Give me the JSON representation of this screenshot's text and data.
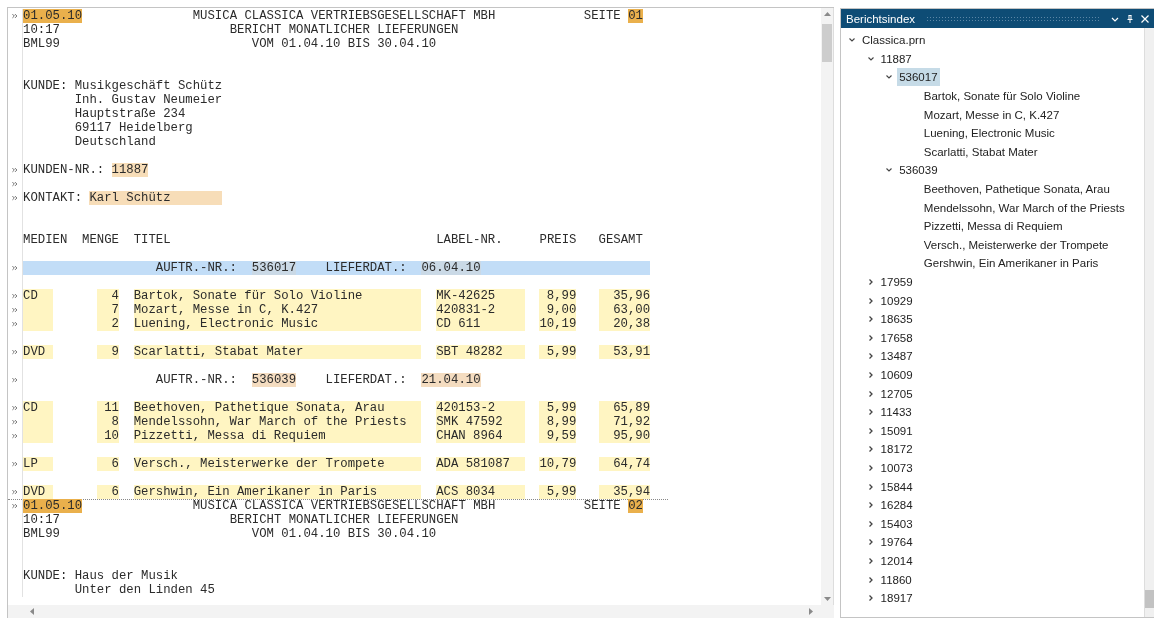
{
  "report": {
    "pages": [
      {
        "date": "01.05.10",
        "company": "MUSICA CLASSICA VERTRIEBSGESELLSCHAFT MBH",
        "page_label": "SEITE",
        "page_no": "01",
        "time": "10:17",
        "title": "BERICHT MONATLICHER LIEFERUNGEN",
        "program": "BML99",
        "period": "VOM 01.04.10 BIS 30.04.10",
        "customer": {
          "label": "KUNDE:",
          "lines": [
            "Musikgeschäft Schütz",
            "Inh. Gustav Neumeier",
            "Hauptstraße 234",
            "69117 Heidelberg",
            "Deutschland"
          ]
        },
        "customer_no": {
          "label": "KUNDEN-NR.:",
          "value": "11887"
        },
        "contact": {
          "label": "KONTAKT:",
          "value": "Karl Schütz"
        },
        "columns": [
          "MEDIEN",
          "MENGE",
          "TITEL",
          "LABEL-NR.",
          "PREIS",
          "GESAMT"
        ],
        "orders": [
          {
            "label": "AUFTR.-NR.:",
            "number": "536017",
            "date_label": "LIEFERDAT.:",
            "date": "06.04.10",
            "selected": true,
            "groups": [
              {
                "media": "CD",
                "items": [
                  {
                    "qty": "4",
                    "title": "Bartok, Sonate für Solo Violine",
                    "label_no": "MK-42625",
                    "price": "8,99",
                    "total": "35,96"
                  },
                  {
                    "qty": "7",
                    "title": "Mozart, Messe in C, K.427",
                    "label_no": "420831-2",
                    "price": "9,00",
                    "total": "63,00"
                  },
                  {
                    "qty": "2",
                    "title": "Luening, Electronic Music",
                    "label_no": "CD 611",
                    "price": "10,19",
                    "total": "20,38"
                  }
                ]
              },
              {
                "media": "DVD",
                "items": [
                  {
                    "qty": "9",
                    "title": "Scarlatti, Stabat Mater",
                    "label_no": "SBT 48282",
                    "price": "5,99",
                    "total": "53,91"
                  }
                ]
              }
            ]
          },
          {
            "label": "AUFTR.-NR.:",
            "number": "536039",
            "date_label": "LIEFERDAT.:",
            "date": "21.04.10",
            "selected": false,
            "groups": [
              {
                "media": "CD",
                "items": [
                  {
                    "qty": "11",
                    "title": "Beethoven, Pathetique Sonata, Arau",
                    "label_no": "420153-2",
                    "price": "5,99",
                    "total": "65,89"
                  },
                  {
                    "qty": "8",
                    "title": "Mendelssohn, War March of the Priests",
                    "label_no": "SMK 47592",
                    "price": "8,99",
                    "total": "71,92"
                  },
                  {
                    "qty": "10",
                    "title": "Pizzetti, Messa di Requiem",
                    "label_no": "CHAN 8964",
                    "price": "9,59",
                    "total": "95,90"
                  }
                ]
              },
              {
                "media": "LP",
                "items": [
                  {
                    "qty": "6",
                    "title": "Versch., Meisterwerke der Trompete",
                    "label_no": "ADA 581087",
                    "price": "10,79",
                    "total": "64,74"
                  }
                ]
              },
              {
                "media": "DVD",
                "items": [
                  {
                    "qty": "6",
                    "title": "Gershwin, Ein Amerikaner in Paris",
                    "label_no": "ACS 8034",
                    "price": "5,99",
                    "total": "35,94"
                  }
                ]
              }
            ]
          }
        ]
      },
      {
        "date": "01.05.10",
        "company": "MUSICA CLASSICA VERTRIEBSGESELLSCHAFT MBH",
        "page_label": "SEITE",
        "page_no": "02",
        "time": "10:17",
        "title": "BERICHT MONATLICHER LIEFERUNGEN",
        "program": "BML99",
        "period": "VOM 01.04.10 BIS 30.04.10",
        "customer": {
          "label": "KUNDE:",
          "lines": [
            "Haus der Musik",
            "Unter den Linden 45"
          ]
        }
      }
    ]
  },
  "index": {
    "title": "Berichtsindex",
    "nodes": [
      {
        "label": "Classica.prn",
        "expanded": true,
        "selected": false,
        "children": [
          {
            "label": "11887",
            "expanded": true,
            "selected": false,
            "children": [
              {
                "label": "536017",
                "expanded": true,
                "selected": true,
                "children": [
                  {
                    "label": "Bartok, Sonate für Solo Violine",
                    "selected": false
                  },
                  {
                    "label": "Mozart, Messe in C, K.427",
                    "selected": false
                  },
                  {
                    "label": "Luening, Electronic Music",
                    "selected": false
                  },
                  {
                    "label": "Scarlatti, Stabat Mater",
                    "selected": false
                  }
                ]
              },
              {
                "label": "536039",
                "expanded": true,
                "selected": false,
                "children": [
                  {
                    "label": "Beethoven, Pathetique Sonata, Arau",
                    "selected": false
                  },
                  {
                    "label": "Mendelssohn, War March of the Priests",
                    "selected": false
                  },
                  {
                    "label": "Pizzetti, Messa di Requiem",
                    "selected": false
                  },
                  {
                    "label": "Versch., Meisterwerke der Trompete",
                    "selected": false
                  },
                  {
                    "label": "Gershwin, Ein Amerikaner in Paris",
                    "selected": false
                  }
                ]
              }
            ]
          },
          {
            "label": "17959",
            "expanded": false,
            "selected": false
          },
          {
            "label": "10929",
            "expanded": false,
            "selected": false
          },
          {
            "label": "18635",
            "expanded": false,
            "selected": false
          },
          {
            "label": "17658",
            "expanded": false,
            "selected": false
          },
          {
            "label": "13487",
            "expanded": false,
            "selected": false
          },
          {
            "label": "10609",
            "expanded": false,
            "selected": false
          },
          {
            "label": "12705",
            "expanded": false,
            "selected": false
          },
          {
            "label": "11433",
            "expanded": false,
            "selected": false
          },
          {
            "label": "15091",
            "expanded": false,
            "selected": false
          },
          {
            "label": "18172",
            "expanded": false,
            "selected": false
          },
          {
            "label": "10073",
            "expanded": false,
            "selected": false
          },
          {
            "label": "15844",
            "expanded": false,
            "selected": false
          },
          {
            "label": "16284",
            "expanded": false,
            "selected": false
          },
          {
            "label": "15403",
            "expanded": false,
            "selected": false
          },
          {
            "label": "19764",
            "expanded": false,
            "selected": false
          },
          {
            "label": "12014",
            "expanded": false,
            "selected": false
          },
          {
            "label": "11860",
            "expanded": false,
            "selected": false
          },
          {
            "label": "18917",
            "expanded": false,
            "selected": false
          }
        ]
      }
    ]
  }
}
